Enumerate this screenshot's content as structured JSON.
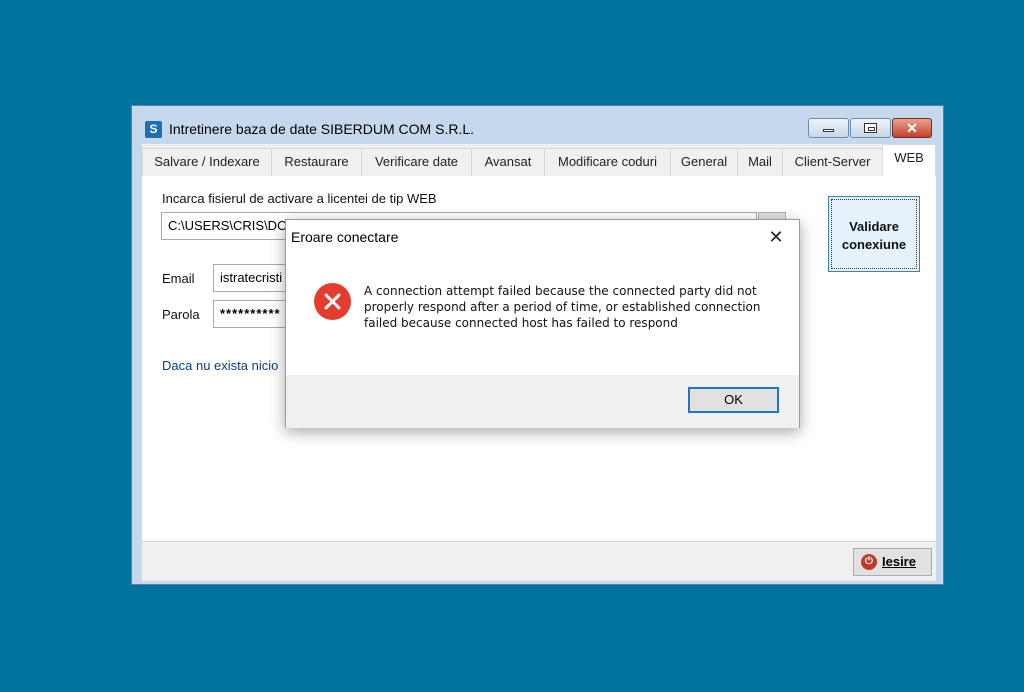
{
  "window": {
    "title": "Intretinere baza de date SIBERDUM COM S.R.L.",
    "icon_letter": "S"
  },
  "tabs": [
    "Salvare / Indexare",
    "Restaurare",
    "Verificare date",
    "Avansat",
    "Modificare coduri",
    "General",
    "Mail",
    "Client-Server",
    "WEB"
  ],
  "active_tab": "WEB",
  "web": {
    "file_label": "Incarca fisierul de activare a licentei de tip WEB",
    "file_path": "C:\\USERS\\CRIS\\DOW",
    "email_label": "Email",
    "email_value": "istratecristi",
    "password_label": "Parola",
    "password_value": "**********",
    "validate_label_1": "Validare",
    "validate_label_2": "conexiune",
    "info_link": "Daca nu exista nicio"
  },
  "footer": {
    "exit_label": "Iesire"
  },
  "dialog": {
    "title": "Eroare conectare",
    "message": "A connection attempt failed because the connected party did not properly respond after a period of time, or established connection failed because connected host has failed to respond",
    "ok_label": "OK",
    "close_glyph": "✕"
  }
}
